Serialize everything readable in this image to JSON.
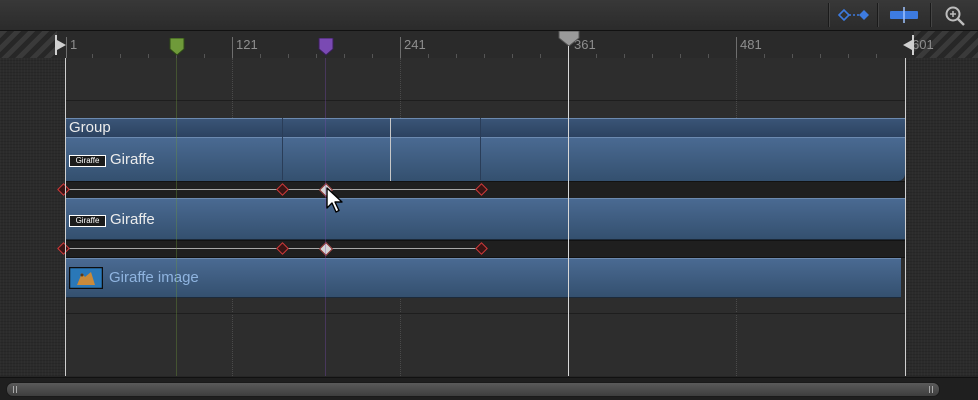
{
  "toolbar": {
    "buttons": [
      {
        "name": "show-keyframes-button",
        "icon": "keyframe-diamonds-icon"
      },
      {
        "name": "snap-button",
        "icon": "snap-bar-icon"
      },
      {
        "name": "zoom-button",
        "icon": "magnifier-icon"
      }
    ]
  },
  "ruler": {
    "ticks": [
      "1",
      "121",
      "241",
      "361",
      "481",
      "601"
    ],
    "playhead_frame": 361,
    "markers": [
      {
        "name": "green-marker",
        "color": "#6f9a3a"
      },
      {
        "name": "purple-marker",
        "color": "#7a4ab3"
      }
    ]
  },
  "tracks": {
    "group": {
      "label": "Group"
    },
    "giraffe_1": {
      "label": "Giraffe",
      "badge": "Giraffe"
    },
    "giraffe_2": {
      "label": "Giraffe",
      "badge": "Giraffe"
    },
    "giraffe_image": {
      "label": "Giraffe image"
    }
  },
  "colors": {
    "track_blue": "#3f5f86",
    "keyframe_red": "#d13a3a",
    "image_label": "#8fb4e0"
  }
}
